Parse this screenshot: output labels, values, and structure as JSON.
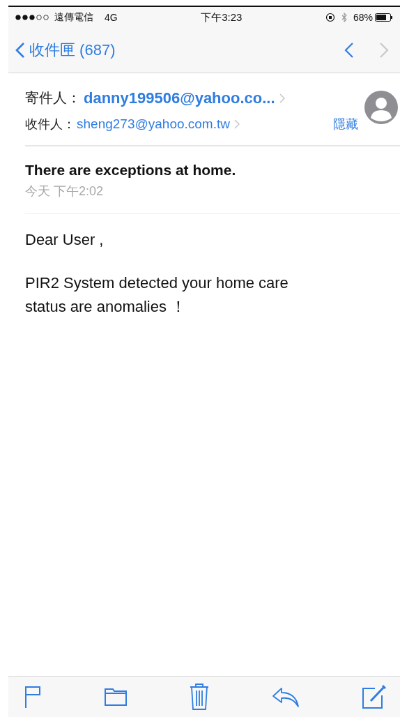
{
  "status_bar": {
    "carrier": "遠傳電信",
    "network": "4G",
    "time": "下午3:23",
    "battery": "68%"
  },
  "nav": {
    "back_label": "收件匣 (687)",
    "prev_disabled": false,
    "next_disabled": true
  },
  "header": {
    "from_label": "寄件人：",
    "from": "danny199506@yahoo.co...",
    "to_label": "收件人：",
    "to": "sheng273@yahoo.com.tw",
    "hide": "隱藏"
  },
  "message": {
    "subject": "There are exceptions at home.",
    "date": "今天 下午2:02",
    "paragraphs": [
      "Dear User ,",
      "PIR2 System detected your home care status are anomalies ！"
    ]
  }
}
